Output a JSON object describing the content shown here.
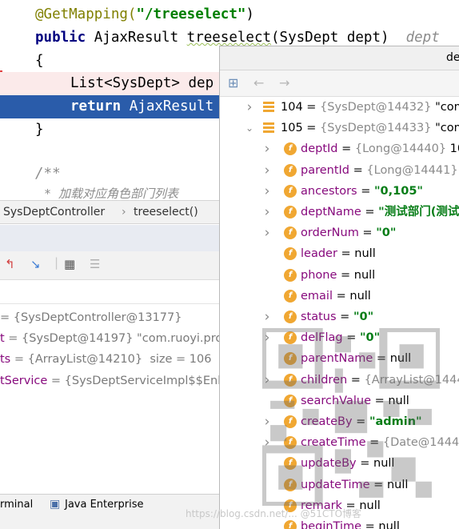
{
  "editor": {
    "annotation": "@GetMapping(",
    "mapping_path": "\"/treeselect\"",
    "annotation_close": ")",
    "kw_public": "public",
    "signature_rest": " AjaxResult ",
    "method_name": "treeselect",
    "signature_args": "(SysDept dept)",
    "inline_hint": "dept",
    "open_brace": "{",
    "line_list": "List<SysDept> dep",
    "kw_return": "return",
    "line_return_rest": " AjaxResult",
    "close_brace": "}",
    "javadoc_open": "/**",
    "javadoc_line": "* 加载对应角色部门列表"
  },
  "breadcrumb": {
    "class_name": "SysDeptController",
    "separator": "›",
    "method": "treeselect()"
  },
  "debugger": {
    "vars": [
      {
        "name": "",
        "value": "= {SysDeptController@13177}"
      },
      {
        "name": "t",
        "value": " = {SysDept@14197} \"com.ruoyi.proj"
      },
      {
        "name": "ts",
        "value": " = {ArrayList@14210}  size = 106"
      },
      {
        "name": "tService",
        "value": " = {SysDeptServiceImpl$$Enh"
      }
    ],
    "bottom_tabs": {
      "terminal": "rminal",
      "java_enterprise": "Java Enterprise"
    }
  },
  "popup": {
    "title": "de",
    "rows": [
      {
        "kind": "obj",
        "expander": "collapsed",
        "name": "104",
        "eq": " = ",
        "type": "{SysDept@14432}",
        "value": " \"com."
      },
      {
        "kind": "obj",
        "expander": "expanded",
        "name": "105",
        "eq": " = ",
        "type": "{SysDept@14433}",
        "value": " \"com."
      },
      {
        "kind": "field",
        "expander": "collapsed",
        "name": "deptId",
        "eq": " = ",
        "type": "{Long@14440}",
        "value": " 10"
      },
      {
        "kind": "field",
        "expander": "collapsed",
        "name": "parentId",
        "eq": " = ",
        "type": "{Long@14441}",
        "value": " 1"
      },
      {
        "kind": "field",
        "expander": "collapsed",
        "name": "ancestors",
        "eq": " = ",
        "type": "",
        "value": "\"0,105\""
      },
      {
        "kind": "field",
        "expander": "collapsed",
        "name": "deptName",
        "eq": " = ",
        "type": "",
        "value": "\"测试部门(测试"
      },
      {
        "kind": "field",
        "expander": "collapsed",
        "name": "orderNum",
        "eq": " = ",
        "type": "",
        "value": "\"0\""
      },
      {
        "kind": "field",
        "expander": "none",
        "name": "leader",
        "eq": " = ",
        "type": "",
        "value": "null"
      },
      {
        "kind": "field",
        "expander": "none",
        "name": "phone",
        "eq": " = ",
        "type": "",
        "value": "null"
      },
      {
        "kind": "field",
        "expander": "none",
        "name": "email",
        "eq": " = ",
        "type": "",
        "value": "null"
      },
      {
        "kind": "field",
        "expander": "collapsed",
        "name": "status",
        "eq": " = ",
        "type": "",
        "value": "\"0\""
      },
      {
        "kind": "field",
        "expander": "collapsed",
        "name": "delFlag",
        "eq": " = ",
        "type": "",
        "value": "\"0\""
      },
      {
        "kind": "field",
        "expander": "none",
        "name": "parentName",
        "eq": " = ",
        "type": "",
        "value": "null"
      },
      {
        "kind": "field",
        "expander": "collapsed",
        "name": "children",
        "eq": " = ",
        "type": "{ArrayList@1444",
        "value": ""
      },
      {
        "kind": "field",
        "expander": "none",
        "name": "searchValue",
        "eq": " = ",
        "type": "",
        "value": "null"
      },
      {
        "kind": "field",
        "expander": "collapsed",
        "name": "createBy",
        "eq": " = ",
        "type": "",
        "value": "\"admin\""
      },
      {
        "kind": "field",
        "expander": "collapsed",
        "name": "createTime",
        "eq": " = ",
        "type": "{Date@1444",
        "value": ""
      },
      {
        "kind": "field",
        "expander": "none",
        "name": "updateBy",
        "eq": " = ",
        "type": "",
        "value": "null"
      },
      {
        "kind": "field",
        "expander": "none",
        "name": "updateTime",
        "eq": " = ",
        "type": "",
        "value": "null"
      },
      {
        "kind": "field",
        "expander": "none",
        "name": "remark",
        "eq": " = ",
        "type": "",
        "value": "null"
      },
      {
        "kind": "field",
        "expander": "none",
        "name": "beginTime",
        "eq": " = ",
        "type": "",
        "value": "null"
      }
    ]
  },
  "watermark": "https://blog.csdn.net/...   @51CTO博客",
  "colors": {
    "selection": "#2a5caa",
    "field_badge": "#f0a732",
    "field_name": "#870a7d",
    "string_value": "#067d17"
  }
}
